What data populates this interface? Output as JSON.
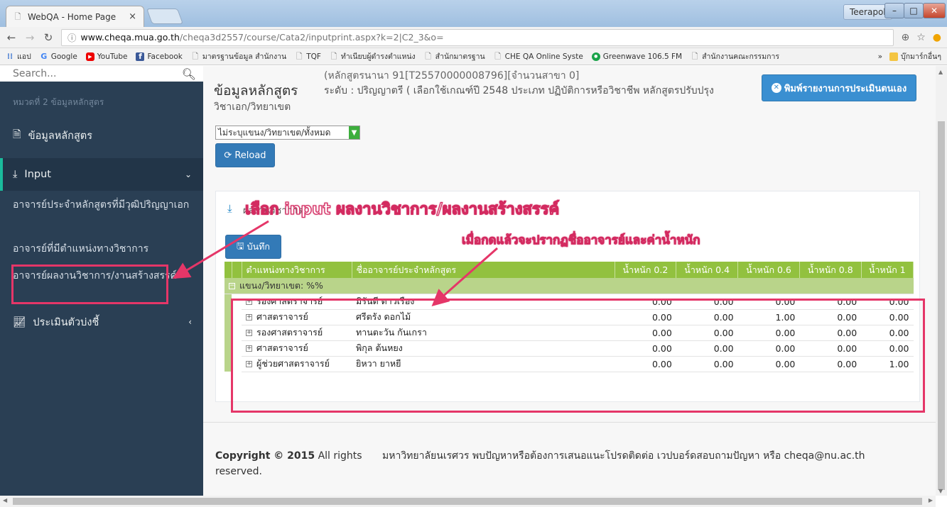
{
  "browser": {
    "tab_title": "WebQA - Home Page",
    "tab_close": "×",
    "user": "Teerapol",
    "url_host": "www.cheqa.mua.go.th",
    "url_path": "/cheqa3d2557/course/Cata2/inputprint.aspx?k=2|C2_3&o=",
    "bookmarks": [
      {
        "label": "แอป",
        "icon": "apps-icon"
      },
      {
        "label": "Google",
        "icon": "google-icon"
      },
      {
        "label": "YouTube",
        "icon": "youtube-icon"
      },
      {
        "label": "Facebook",
        "icon": "facebook-icon"
      },
      {
        "label": "มาตรฐานข้อมูล สำนักงาน",
        "icon": "page-icon"
      },
      {
        "label": "TQF",
        "icon": "page-icon"
      },
      {
        "label": "ทำเนียบผู้ดำรงตำแหน่ง",
        "icon": "page-icon"
      },
      {
        "label": "สำนักมาตรฐาน",
        "icon": "page-icon"
      },
      {
        "label": "CHE QA Online Syste",
        "icon": "page-icon"
      },
      {
        "label": "Greenwave 106.5 FM",
        "icon": "greenwave-icon"
      },
      {
        "label": "สำนักงานคณะกรรมการ",
        "icon": "page-icon"
      }
    ],
    "bookmarks_more": "»",
    "other_bookmarks": "บุ๊กมาร์กอื่นๆ"
  },
  "sidebar": {
    "search_placeholder": "Search...",
    "section_title": "หมวดที่ 2 ข้อมูลหลักสูตร",
    "item_data": "ข้อมูลหลักสูตร",
    "item_input": "Input",
    "sub_items": [
      "อาจารย์ประจำหลักสูตรที่มีวุฒิปริญญาเอก",
      "อาจารย์ที่มีตำแหน่งทางวิชาการ",
      "อาจารย์ผลงานวิชาการ/งานสร้างสรรค์"
    ],
    "item_assess": "ประเมินตัวบ่งชี้"
  },
  "header": {
    "subtitle": "(หลักสูตรนานา 91[T25570000008796][จำนวนสาขา 0]",
    "title": "ข้อมูลหลักสูตร",
    "meta": "ระดับ : ปริญญาตรี ( เลือกใช้เกณฑ์ปี 2548 ประเภท ปฏิบัติการหรือวิชาชีพ หลักสูตรปรับปรุง",
    "major_label": "วิชาเอก/วิทยาเขต",
    "print_button": "พิมพ์รายงานการประเมินตนเอง"
  },
  "controls": {
    "branch_select": "ไม่ระบุแขนง/วิทยาเขต/ทั้งหมด",
    "reload_button": "Reload"
  },
  "panel": {
    "title": "ผลงานวิชาการ",
    "save_button": "บันทึก",
    "columns": [
      "ตำแหน่งทางวิชาการ",
      "ชื่ออาจารย์ประจำหลักสูตร",
      "น้ำหนัก 0.2",
      "น้ำหนัก 0.4",
      "น้ำหนัก 0.6",
      "น้ำหนัก 0.8",
      "น้ำหนัก 1"
    ],
    "group_label": "แขนง/วิทยาเขต: %%",
    "rows": [
      {
        "position": "รองศาสตราจารย์",
        "name": "มิรันตี ดาวเรือง",
        "w02": "0.00",
        "w04": "0.00",
        "w06": "0.00",
        "w08": "0.00",
        "w1": "0.00"
      },
      {
        "position": "ศาสตราจารย์",
        "name": "ศรีตรัง ดอกไม้",
        "w02": "0.00",
        "w04": "0.00",
        "w06": "1.00",
        "w08": "0.00",
        "w1": "0.00"
      },
      {
        "position": "รองศาสตราจารย์",
        "name": "ทานตะวัน กันเกรา",
        "w02": "0.00",
        "w04": "0.00",
        "w06": "0.00",
        "w08": "0.00",
        "w1": "0.00"
      },
      {
        "position": "ศาสตราจารย์",
        "name": "พิกุล ต้นหยง",
        "w02": "0.00",
        "w04": "0.00",
        "w06": "0.00",
        "w08": "0.00",
        "w1": "0.00"
      },
      {
        "position": "ผู้ช่วยศาสตราจารย์",
        "name": "ยิหวา ยาหยี",
        "w02": "0.00",
        "w04": "0.00",
        "w06": "0.00",
        "w08": "0.00",
        "w1": "1.00"
      }
    ]
  },
  "footer": {
    "copyright_bold": "Copyright © 2015",
    "copyright_rest": " All rights reserved.",
    "contact": "มหาวิทยาลัยนเรศวร พบปัญหาหรือต้องการเสนอแนะโปรดติดต่อ เวปบอร์ดสอบถามปัญหา หรือ cheqa@nu.ac.th"
  },
  "annotations": {
    "select_input": "เลือก input ผลงานวิชาการ/ผลงานสร้างสรรค์",
    "after_click": "เมื่อกดแล้วจะปรากฏชื่ออาจารย์และค่าน้ำหนัก"
  },
  "colors": {
    "sidebar_bg": "#2a3f54",
    "table_header": "#92c13f",
    "primary_button": "#337ab7",
    "annotation": "#e53668"
  }
}
